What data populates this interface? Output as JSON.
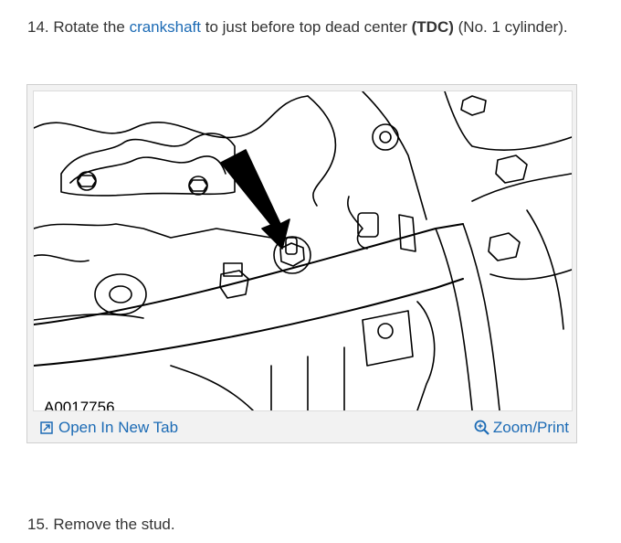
{
  "steps": [
    {
      "number": "14.",
      "text_before": "Rotate the",
      "link_text": "crankshaft",
      "text_middle": "to just before top dead center",
      "bold_text": "(TDC)",
      "text_after": "(No. 1 cylinder)."
    },
    {
      "number": "15.",
      "text": "Remove the stud."
    }
  ],
  "figure": {
    "id_label": "A0017756",
    "open_tab_label": "Open In New Tab",
    "zoom_label": "Zoom/Print",
    "icons": {
      "open_tab": "open-new-tab-icon",
      "zoom": "magnifier-icon"
    }
  },
  "colors": {
    "link": "#1c6bb5",
    "text": "#333333",
    "frame": "#f2f2f2"
  }
}
